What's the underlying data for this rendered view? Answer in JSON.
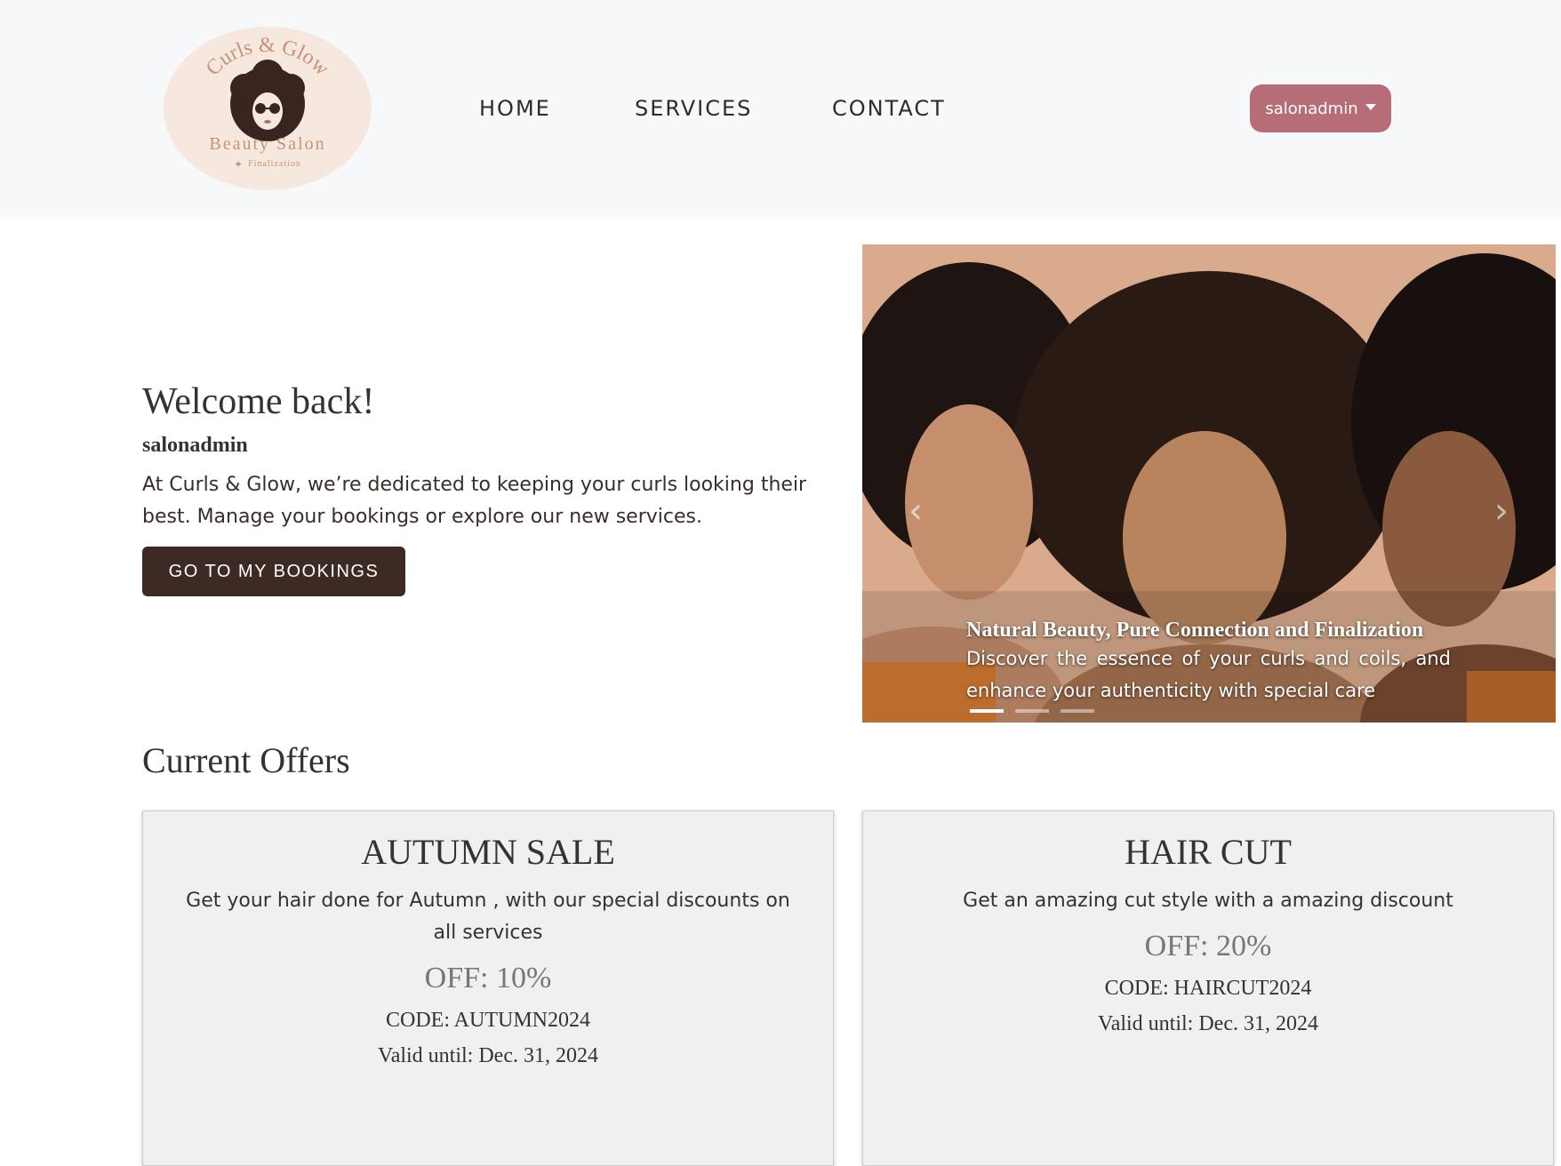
{
  "header": {
    "logo": {
      "arc_text": "Curls & Glow",
      "title": "Beauty Salon",
      "tagline": "Finalization"
    },
    "nav": [
      {
        "label": "HOME"
      },
      {
        "label": "SERVICES"
      },
      {
        "label": "CONTACT"
      }
    ],
    "user_menu_label": "salonadmin"
  },
  "welcome": {
    "title": "Welcome back!",
    "username": "salonadmin",
    "text": "At Curls & Glow, we’re dedicated to keeping your curls looking their best. Manage your bookings or explore our new services.",
    "button_label": "GO TO MY BOOKINGS"
  },
  "carousel": {
    "caption_title": "Natural Beauty, Pure Connection and Finalization",
    "caption_text": "Discover the essence of your curls and coils, and enhance your authenticity with special care",
    "prev_icon": "‹",
    "next_icon": "›",
    "active_slide": 1,
    "slide_count": 3
  },
  "offers": {
    "title": "Current Offers",
    "items": [
      {
        "name": "AUTUMN SALE",
        "description": "Get your hair done for Autumn , with our special discounts on all services",
        "discount": "OFF: 10%",
        "code": "CODE: AUTUMN2024",
        "valid": "Valid until: Dec. 31, 2024"
      },
      {
        "name": "HAIR CUT",
        "description": "Get an amazing cut style with a amazing discount",
        "discount": "OFF: 20%",
        "code": "CODE: HAIRCUT2024",
        "valid": "Valid until: Dec. 31, 2024"
      }
    ]
  },
  "colors": {
    "header_bg": "#f7f8fa",
    "user_button": "#b76d78",
    "bookings_button": "#3d2a25",
    "card_bg": "#f0f0f0"
  }
}
